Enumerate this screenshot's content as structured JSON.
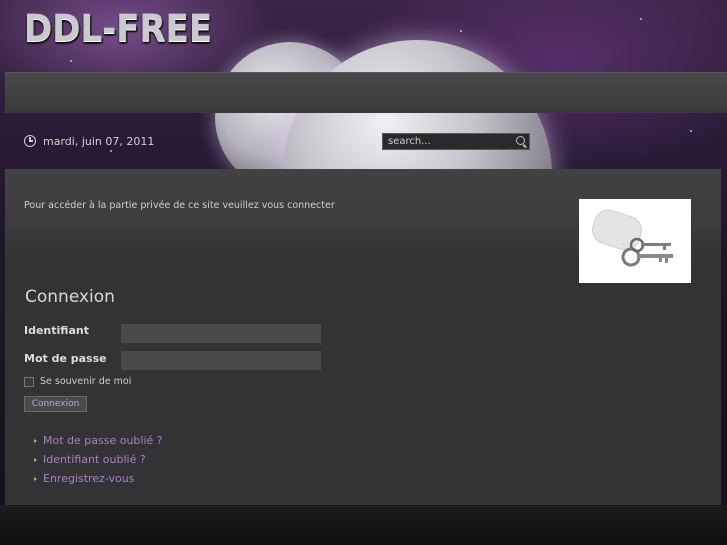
{
  "header": {
    "logo_text": "DDL-FREE",
    "date": "mardi, juin 07, 2011",
    "search_placeholder": "search..."
  },
  "main": {
    "notice": "Pour accéder à la partie privée de ce site veuillez vous connecter",
    "title": "Connexion",
    "username_label": "Identifiant",
    "password_label": "Mot de passe",
    "remember_label": "Se souvenir de moi",
    "login_button": "Connexion",
    "links": [
      "Mot de passe oublié ?",
      "Identifiant oublié ?",
      "Enregistrez-vous"
    ]
  },
  "colors": {
    "link": "#a880c8",
    "panel": "#333335"
  }
}
